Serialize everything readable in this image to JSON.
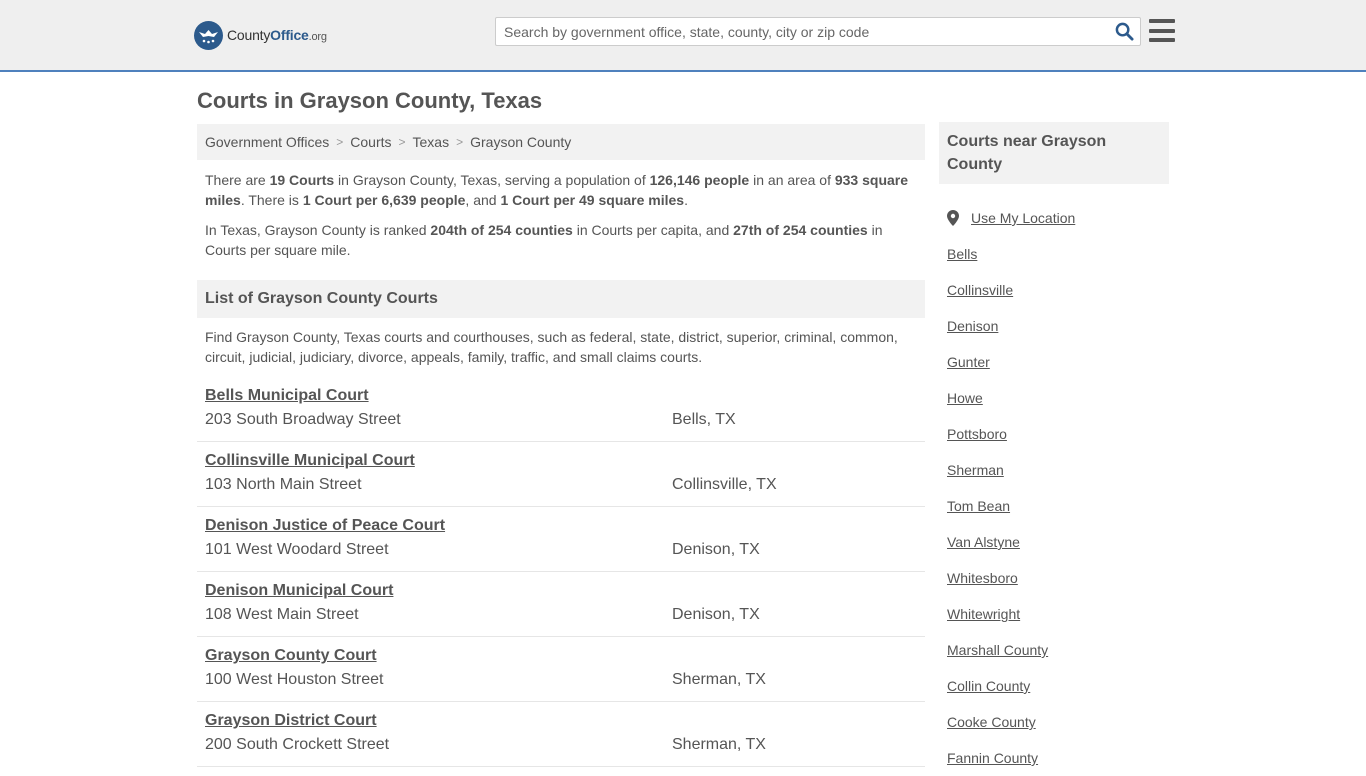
{
  "header": {
    "logo_main": "County",
    "logo_bold": "Office",
    "logo_tld": ".org",
    "search_placeholder": "Search by government office, state, county, city or zip code"
  },
  "page_title": "Courts in Grayson County, Texas",
  "breadcrumb": [
    "Government Offices",
    "Courts",
    "Texas",
    "Grayson County"
  ],
  "intro": {
    "p1": {
      "t1": "There are ",
      "b1": "19 Courts",
      "t2": " in Grayson County, Texas, serving a population of ",
      "b2": "126,146 people",
      "t3": " in an area of ",
      "b3": "933 square miles",
      "t4": ". There is ",
      "b4": "1 Court per 6,639 people",
      "t5": ", and ",
      "b5": "1 Court per 49 square miles",
      "t6": "."
    },
    "p2": {
      "t1": "In Texas, Grayson County is ranked ",
      "b1": "204th of 254 counties",
      "t2": " in Courts per capita, and ",
      "b2": "27th of 254 counties",
      "t3": " in Courts per square mile."
    }
  },
  "list": {
    "heading": "List of Grayson County Courts",
    "description": "Find Grayson County, Texas courts and courthouses, such as federal, state, district, superior, criminal, common, circuit, judicial, judiciary, divorce, appeals, family, traffic, and small claims courts.",
    "courts": [
      {
        "name": "Bells Municipal Court",
        "address": "203 South Broadway Street",
        "city": "Bells, TX"
      },
      {
        "name": "Collinsville Municipal Court",
        "address": "103 North Main Street",
        "city": "Collinsville, TX"
      },
      {
        "name": "Denison Justice of Peace Court",
        "address": "101 West Woodard Street",
        "city": "Denison, TX"
      },
      {
        "name": "Denison Municipal Court",
        "address": "108 West Main Street",
        "city": "Denison, TX"
      },
      {
        "name": "Grayson County Court",
        "address": "100 West Houston Street",
        "city": "Sherman, TX"
      },
      {
        "name": "Grayson District Court",
        "address": "200 South Crockett Street",
        "city": "Sherman, TX"
      }
    ]
  },
  "sidebar": {
    "heading": "Courts near Grayson County",
    "use_location": "Use My Location",
    "links": [
      "Bells",
      "Collinsville",
      "Denison",
      "Gunter",
      "Howe",
      "Pottsboro",
      "Sherman",
      "Tom Bean",
      "Van Alstyne",
      "Whitesboro",
      "Whitewright",
      "Marshall County",
      "Collin County",
      "Cooke County",
      "Fannin County"
    ]
  },
  "colors": {
    "accent": "#4f81bd",
    "logo_blue": "#2c5a8c",
    "search_icon": "#2c5a8c",
    "text": "#555555"
  }
}
